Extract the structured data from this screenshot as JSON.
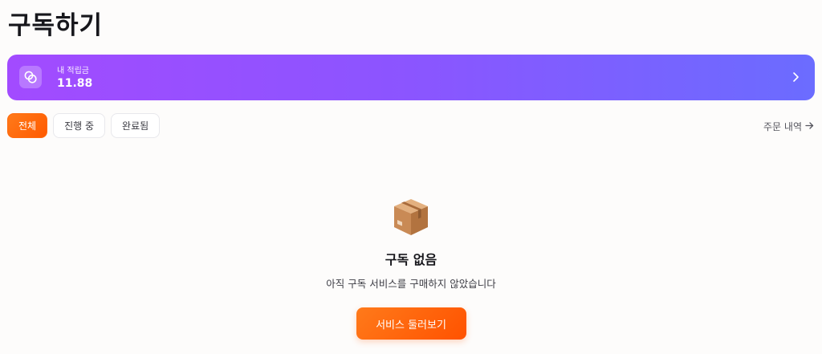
{
  "page": {
    "title": "구독하기"
  },
  "balance": {
    "label": "내 적립금",
    "value": "11.88",
    "icon": "coins-icon",
    "chevron_icon": "chevron-right-icon"
  },
  "tabs": [
    {
      "label": "전체",
      "active": true
    },
    {
      "label": "진행 중",
      "active": false
    },
    {
      "label": "완료됨",
      "active": false
    }
  ],
  "order_history": {
    "label": "주문 내역",
    "icon": "arrow-right-icon"
  },
  "empty_state": {
    "icon": "package-box-icon",
    "title": "구독 없음",
    "description": "아직 구독 서비스를 구매하지 않았습니다",
    "button_label": "서비스 둘러보기"
  },
  "colors": {
    "accent_orange": "#ff6a0d",
    "card_gradient_start": "#a24bff",
    "card_gradient_end": "#6b6cff"
  }
}
